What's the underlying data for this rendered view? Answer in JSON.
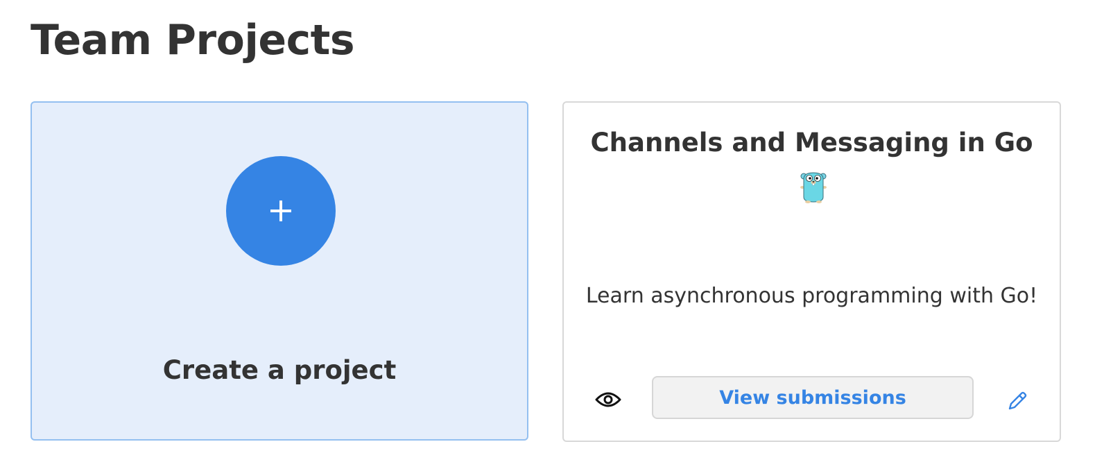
{
  "page": {
    "title": "Team Projects"
  },
  "create_card": {
    "label": "Create a project",
    "icon": "plus-icon",
    "accent": "#3584e4"
  },
  "project": {
    "title": "Channels and Messaging in Go",
    "image": "go-gopher-icon",
    "description": "Learn asynchronous programming with Go!",
    "actions": {
      "preview_icon": "eye-icon",
      "view_submissions_label": "View submissions",
      "edit_icon": "pencil-icon"
    }
  },
  "colors": {
    "accent": "#3584e4",
    "create_card_bg": "#e5eefb",
    "text": "#333333"
  }
}
